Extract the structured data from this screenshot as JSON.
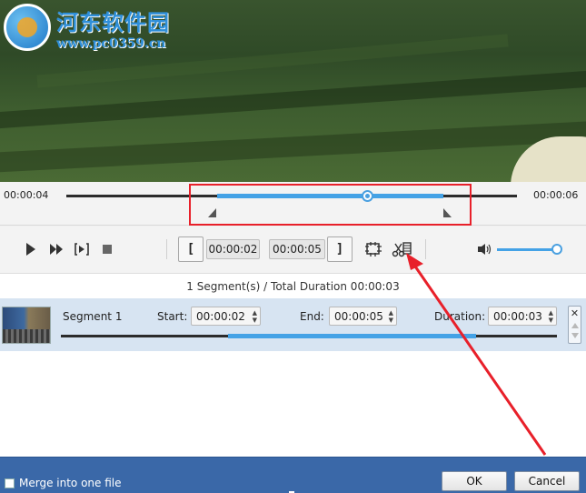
{
  "watermark": {
    "title": "河东软件园",
    "url": "www.pc0359.cn"
  },
  "timeline": {
    "start_time": "00:00:04",
    "end_time": "00:00:06",
    "selection_start_fraction": 0.33,
    "selection_end_fraction": 0.838,
    "playhead_fraction": 0.666
  },
  "controls": {
    "play_icon": "play-icon",
    "fast_forward_icon": "fast-forward-icon",
    "frame_step_icon": "frame-step-icon",
    "stop_icon": "stop-icon",
    "set_start_label": "[",
    "start_time": "00:00:02",
    "end_time": "00:00:05",
    "set_end_label": "]",
    "add_segment_icon": "film-add-icon",
    "split_icon": "scissors-film-icon",
    "volume_icon": "speaker-icon",
    "volume_level": 1.0
  },
  "summary": {
    "text": "1 Segment(s) / Total Duration 00:00:03"
  },
  "segments": [
    {
      "name": "Segment 1",
      "start_label": "Start:",
      "start": "00:00:02",
      "end_label": "End:",
      "end": "00:00:05",
      "duration_label": "Duration:",
      "duration": "00:00:03",
      "range_start_fraction": 0.335,
      "range_end_fraction": 0.835
    }
  ],
  "footer": {
    "merge_label": "Merge into one file",
    "merge_checked": false,
    "ok_label": "OK",
    "cancel_label": "Cancel"
  },
  "colors": {
    "accent": "#44a2e6",
    "annotation": "#e8202a",
    "footer": "#3a68a8"
  }
}
